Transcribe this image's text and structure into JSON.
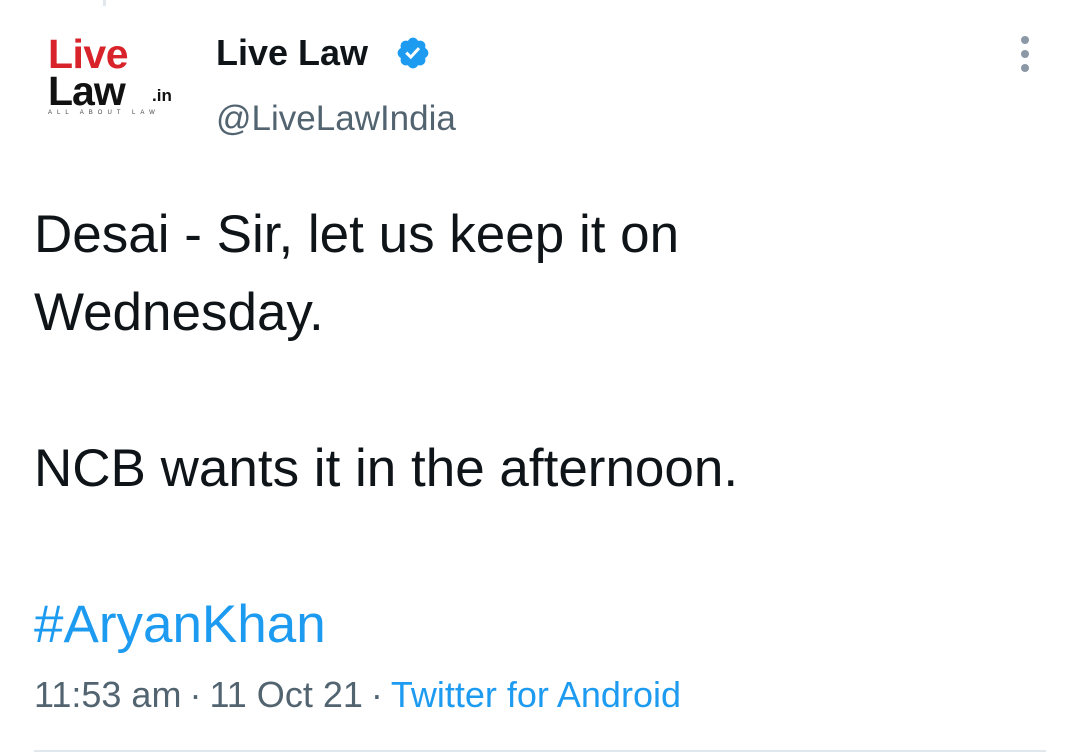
{
  "author": {
    "display_name": "Live Law",
    "handle": "@LiveLawIndia",
    "verified": true,
    "avatar_icon": "livelaw-logo-icon",
    "avatar_logo": {
      "word1": "Live",
      "word2": "Law",
      "suffix": ".in",
      "tagline": "ALL ABOUT LAW"
    }
  },
  "tweet": {
    "lines": [
      "Desai - Sir, let us keep it on",
      "Wednesday.",
      "NCB wants it in the afternoon."
    ],
    "hashtag": "#AryanKhan"
  },
  "meta": {
    "time": "11:53 am",
    "separator": "·",
    "date": "11 Oct 21",
    "source": "Twitter for Android"
  },
  "colors": {
    "link": "#1d9bf0",
    "text": "#0f1419",
    "secondary": "#536471",
    "brand_red": "#d9232a"
  }
}
